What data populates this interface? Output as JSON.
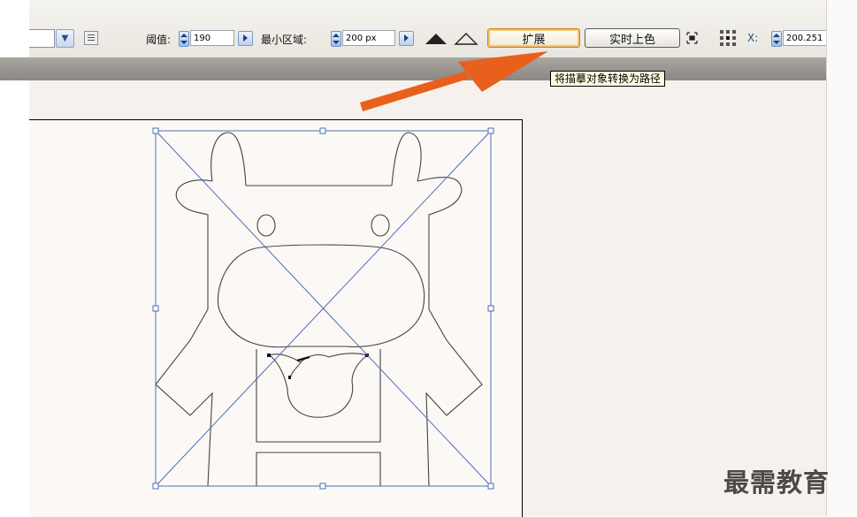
{
  "toolbar": {
    "threshold_label": "阈值:",
    "threshold_value": "190",
    "min_area_label": "最小区域:",
    "min_area_value": "200 px",
    "expand_button": "扩展",
    "live_paint_button": "实时上色",
    "x_label": "X:",
    "x_value": "200.251"
  },
  "tooltip": {
    "text": "将描摹对象转换为路径"
  },
  "watermark": {
    "text": "最需教育"
  },
  "colors": {
    "selection_blue": "#4a6fb5",
    "arrow_orange": "#e8601c",
    "workspace_bg": "#f7f1ed",
    "band_gray": "#8f8b86"
  },
  "icons": [
    "chevron-down-icon",
    "tracing-options-icon",
    "spinner-icon",
    "right-arrow-icon",
    "filled-triangle-icon",
    "outline-triangle-icon",
    "view-icon",
    "reference-point-icon"
  ]
}
